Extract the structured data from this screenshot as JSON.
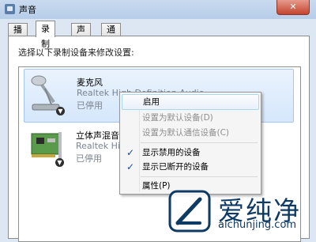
{
  "window": {
    "title": "声音",
    "close_label": "✕"
  },
  "tabs": [
    {
      "label": "播放",
      "active": false
    },
    {
      "label": "录制",
      "active": true
    },
    {
      "label": "声音",
      "active": false
    },
    {
      "label": "通信",
      "active": false
    }
  ],
  "instruction": "选择以下录制设备来修改设置:",
  "devices": [
    {
      "name": "麦克风",
      "driver": "Realtek High Definition Audio",
      "status": "已停用",
      "icon": "microphone-icon",
      "selected": true
    },
    {
      "name": "立体声混音",
      "driver": "Realtek High D",
      "status": "已停用",
      "icon": "sound-card-icon",
      "selected": false
    }
  ],
  "context_menu": {
    "items": [
      {
        "label": "启用",
        "highlighted": true,
        "disabled": false,
        "checked": false
      },
      {
        "label": "设置为默认设备(D)",
        "highlighted": false,
        "disabled": true,
        "checked": false
      },
      {
        "label": "设置为默认通信设备(C)",
        "highlighted": false,
        "disabled": true,
        "checked": false
      },
      {
        "label": "显示禁用的设备",
        "highlighted": false,
        "disabled": false,
        "checked": true
      },
      {
        "label": "显示已断开的设备",
        "highlighted": false,
        "disabled": false,
        "checked": true
      },
      {
        "label": "属性(P)",
        "highlighted": false,
        "disabled": false,
        "checked": false
      }
    ],
    "check_glyph": "✓"
  },
  "watermark": {
    "text": "爱纯净",
    "url": "aichunjing.com"
  }
}
